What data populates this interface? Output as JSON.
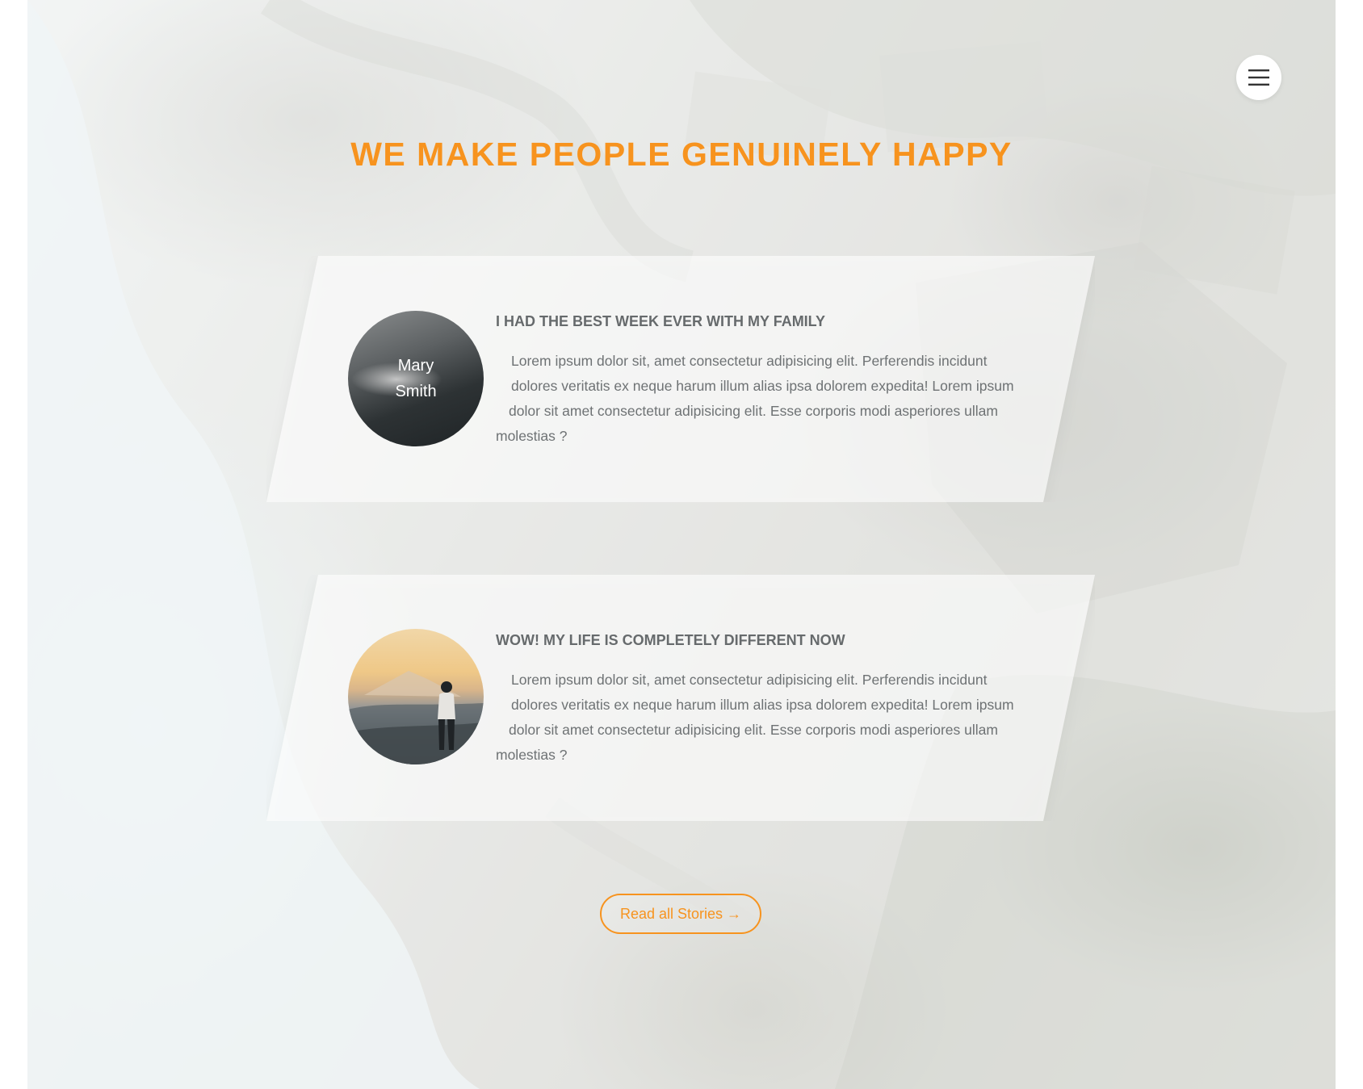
{
  "menu": {
    "icon": "hamburger-menu-icon"
  },
  "headline": "WE MAKE PEOPLE GENUINELY HAPPY",
  "stories": [
    {
      "avatar_name": [
        "Mary",
        "Smith"
      ],
      "title": "I HAD THE BEST WEEK EVER WITH MY FAMILY",
      "text_lines": [
        "Lorem ipsum dolor sit, amet consectetur adipisicing elit. Perferendis incidunt",
        "dolores veritatis ex neque harum illum alias ipsa dolorem expedita! Lorem ipsum",
        "dolor sit amet consectetur adipisicing elit. Esse corporis modi asperiores ullam",
        "molestias ?"
      ]
    },
    {
      "avatar_image": "person-on-mountain-photo",
      "title": "WOW! MY LIFE IS COMPLETELY DIFFERENT NOW",
      "text_lines": [
        "Lorem ipsum dolor sit, amet consectetur adipisicing elit. Perferendis incidunt",
        "dolores veritatis ex neque harum illum alias ipsa dolorem expedita! Lorem ipsum",
        "dolor sit amet consectetur adipisicing elit. Esse corporis modi asperiores ullam",
        "molestias ?"
      ]
    }
  ],
  "read_all_button": "Read all Stories →",
  "colors": {
    "accent": "#f7931e",
    "text": "#6e7274"
  }
}
